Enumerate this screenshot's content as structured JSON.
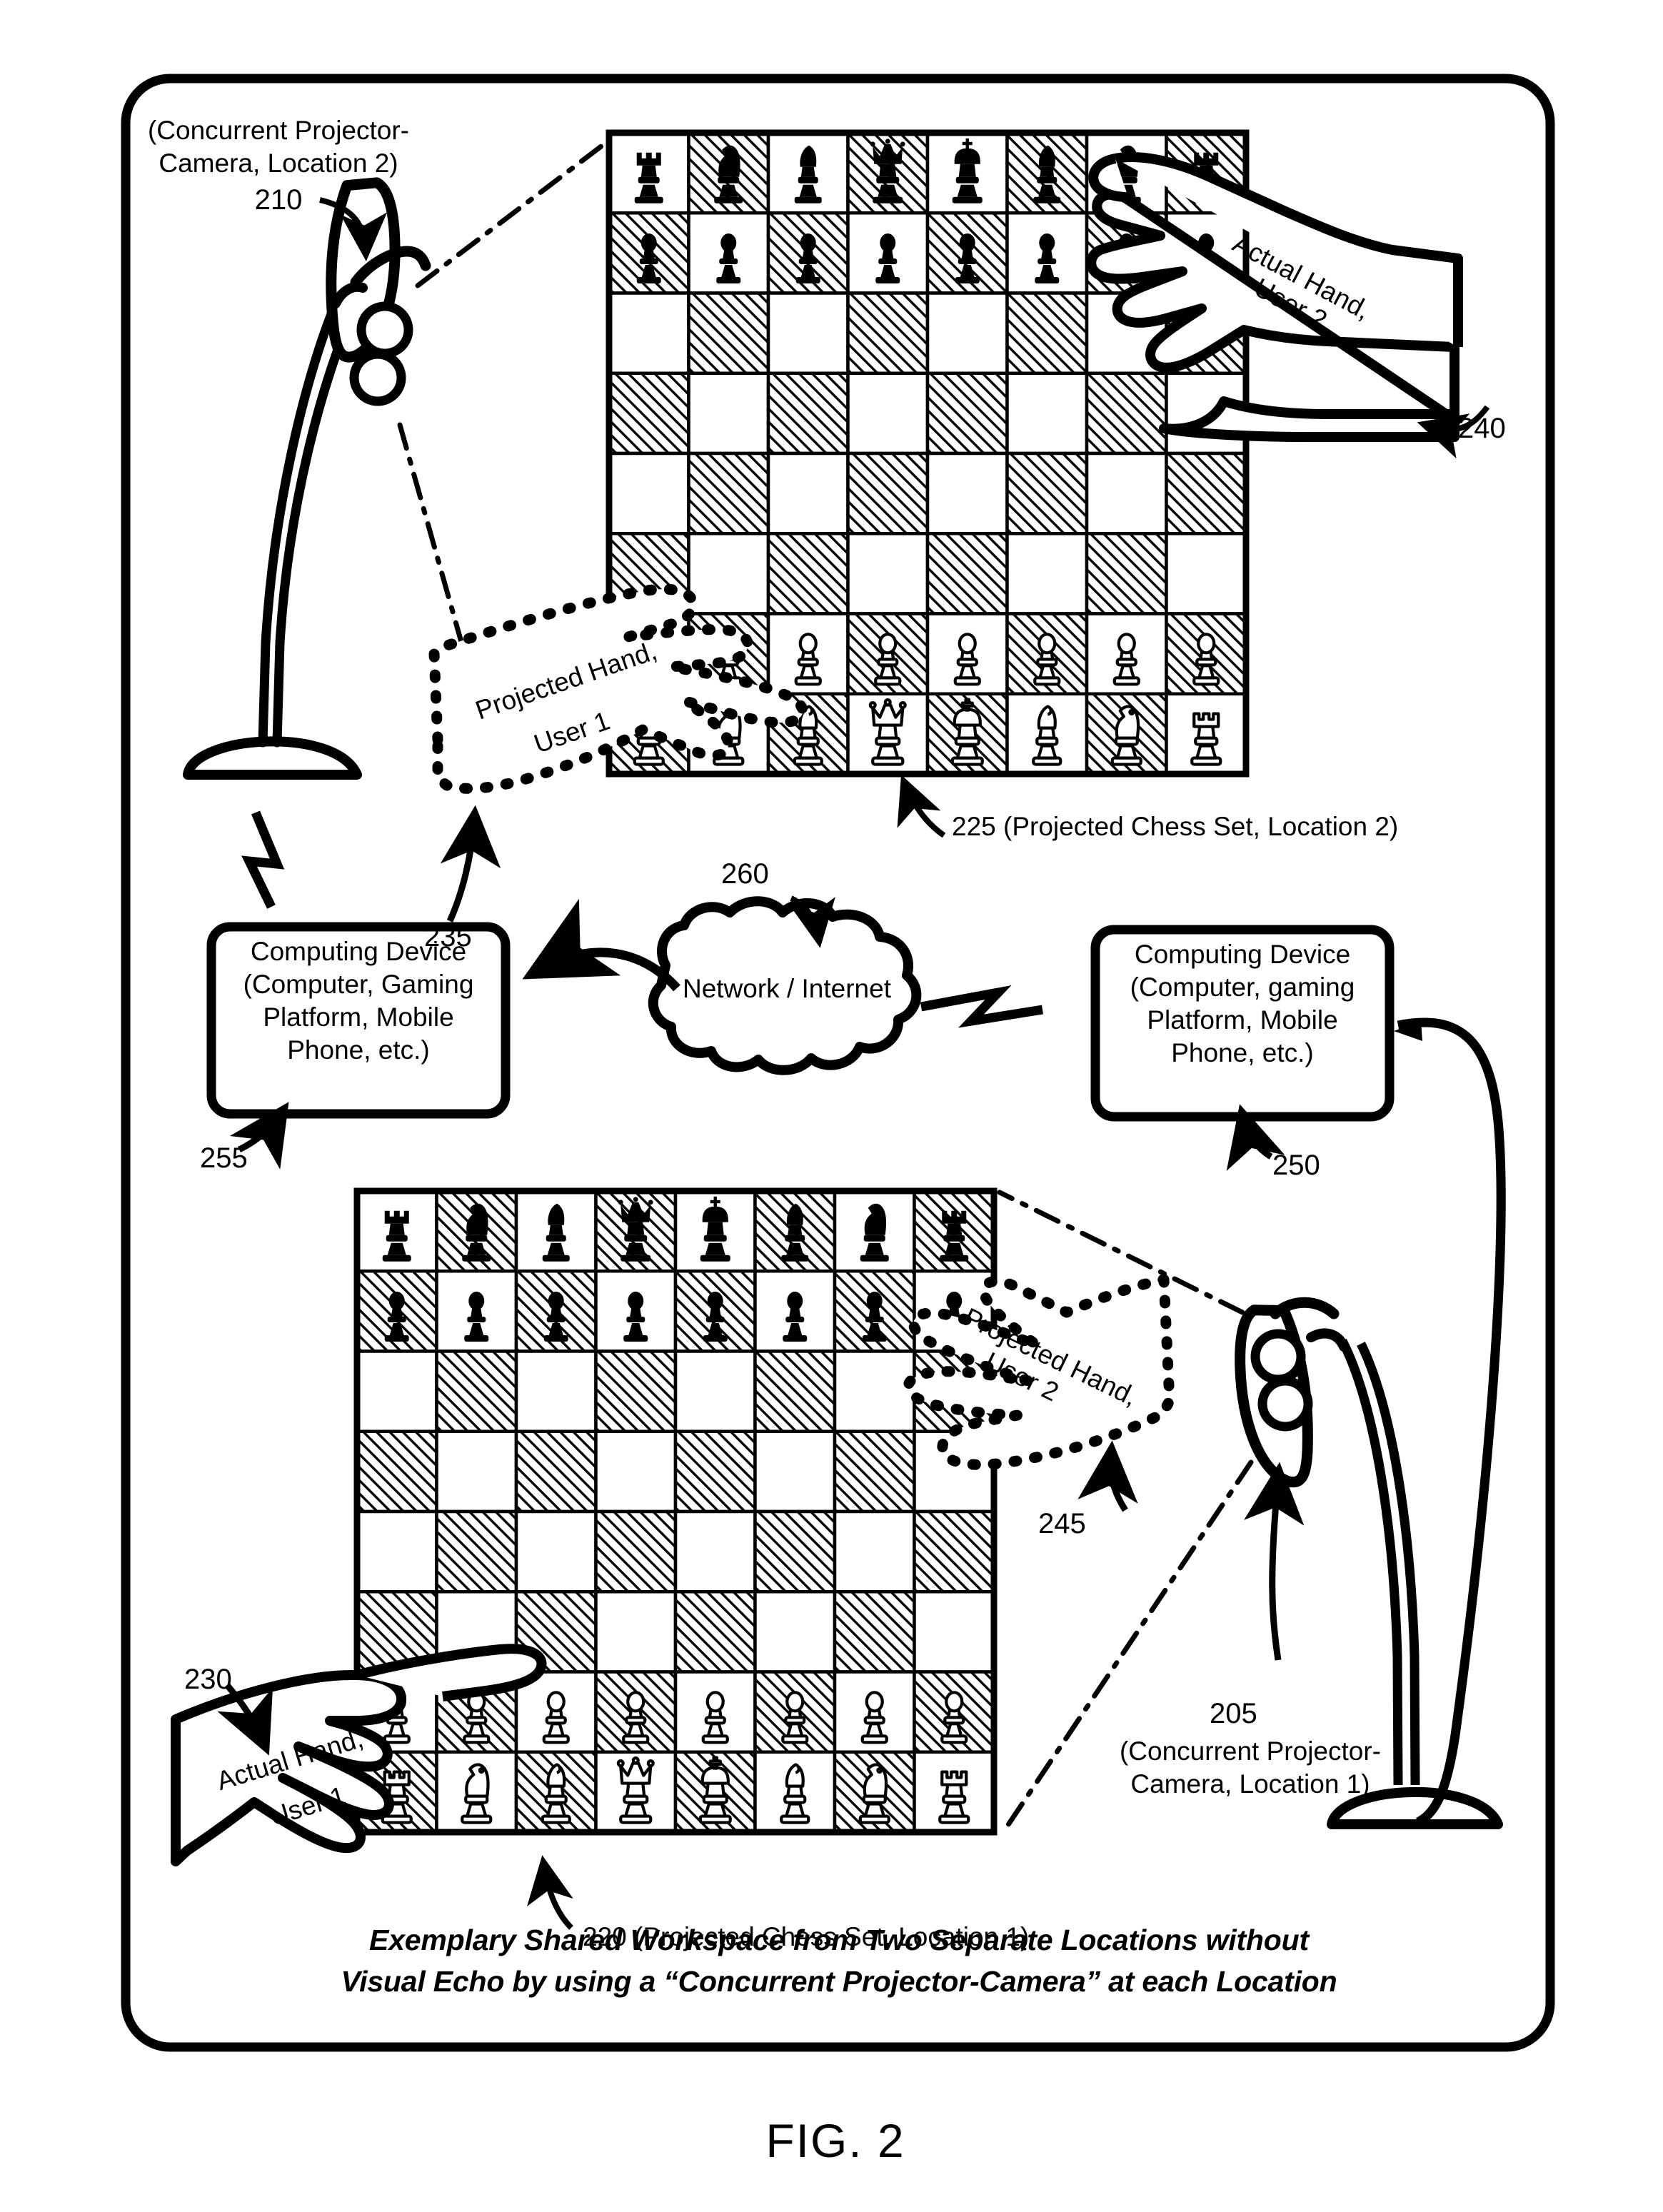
{
  "figure": {
    "number_label": "FIG. 2",
    "caption_line1": "Exemplary Shared Workspace from Two Separate Locations without",
    "caption_line2": "Visual Echo by using a “Concurrent Projector-Camera” at each Location"
  },
  "labels": {
    "projcam2_title_l1": "(Concurrent Projector-",
    "projcam2_title_l2": "Camera, Location 2)",
    "projcam2_ref": "210",
    "projcam1_ref": "205",
    "projcam1_title_l1": "(Concurrent Projector-",
    "projcam1_title_l2": "Camera, Location 1)",
    "actual_hand_u2_l1": "Actual Hand,",
    "actual_hand_u2_l2": "User 2",
    "actual_hand_u2_ref": "240",
    "projected_hand_u1_l1": "Projected Hand,",
    "projected_hand_u1_l2": "User 1",
    "projected_hand_u1_ref": "235",
    "projected_chess_2_ref": "225 (Projected Chess Set, Location 2)",
    "projected_hand_u2_l1": "Projected Hand,",
    "projected_hand_u2_l2": "User 2",
    "projected_hand_u2_ref": "245",
    "actual_hand_u1_l1": "Actual Hand,",
    "actual_hand_u1_l2": "User 1",
    "actual_hand_u1_ref": "230",
    "projected_chess_1_ref": "220 (Projected Chess Set, Location 1)",
    "network_ref": "260",
    "computing_left_ref": "255",
    "computing_right_ref": "250"
  },
  "network_cloud": {
    "text": "Network / Internet"
  },
  "computing_device_left": {
    "line1": "Computing Device",
    "line2": "(Computer, Gaming",
    "line3": "Platform, Mobile",
    "line4": "Phone, etc.)"
  },
  "computing_device_right": {
    "line1": "Computing Device",
    "line2": "(Computer, gaming",
    "line3": "Platform, Mobile",
    "line4": "Phone, etc.)"
  },
  "chess": {
    "colors": {
      "light_square": "#ffffff",
      "dark_square_hatch": "#000000",
      "piece_black": "#000000",
      "piece_white_outline": "#000000"
    },
    "board_top": {
      "name": "Projected Chess Set, Location 2",
      "ranks": [
        [
          "bR",
          "bN",
          "bB",
          "bQ",
          "bK",
          "bB",
          "bN",
          "bR"
        ],
        [
          "bP",
          "bP",
          "bP",
          "bP",
          "bP",
          "bP",
          "bP",
          "bP"
        ],
        [
          "",
          "",
          "",
          "",
          "",
          "",
          "",
          ""
        ],
        [
          "",
          "",
          "",
          "",
          "",
          "",
          "",
          ""
        ],
        [
          "",
          "",
          "",
          "",
          "",
          "",
          "",
          ""
        ],
        [
          "",
          "",
          "",
          "",
          "",
          "",
          "",
          ""
        ],
        [
          "wP",
          "wP",
          "wP",
          "wP",
          "wP",
          "wP",
          "wP",
          "wP"
        ],
        [
          "wR",
          "wN",
          "wB",
          "wQ",
          "wK",
          "wB",
          "wN",
          "wR"
        ]
      ]
    },
    "board_bottom": {
      "name": "Projected Chess Set, Location 1",
      "ranks": [
        [
          "bR",
          "bN",
          "bB",
          "bQ",
          "bK",
          "bB",
          "bN",
          "bR"
        ],
        [
          "bP",
          "bP",
          "bP",
          "bP",
          "bP",
          "bP",
          "bP",
          "bP"
        ],
        [
          "",
          "",
          "",
          "",
          "",
          "",
          "",
          ""
        ],
        [
          "",
          "",
          "",
          "",
          "",
          "",
          "",
          ""
        ],
        [
          "",
          "",
          "",
          "",
          "",
          "",
          "",
          ""
        ],
        [
          "",
          "",
          "",
          "",
          "",
          "",
          "",
          ""
        ],
        [
          "wP",
          "wP",
          "wP",
          "wP",
          "wP",
          "wP",
          "wP",
          "wP"
        ],
        [
          "wR",
          "wN",
          "wB",
          "wQ",
          "wK",
          "wB",
          "wN",
          "wR"
        ]
      ]
    }
  }
}
